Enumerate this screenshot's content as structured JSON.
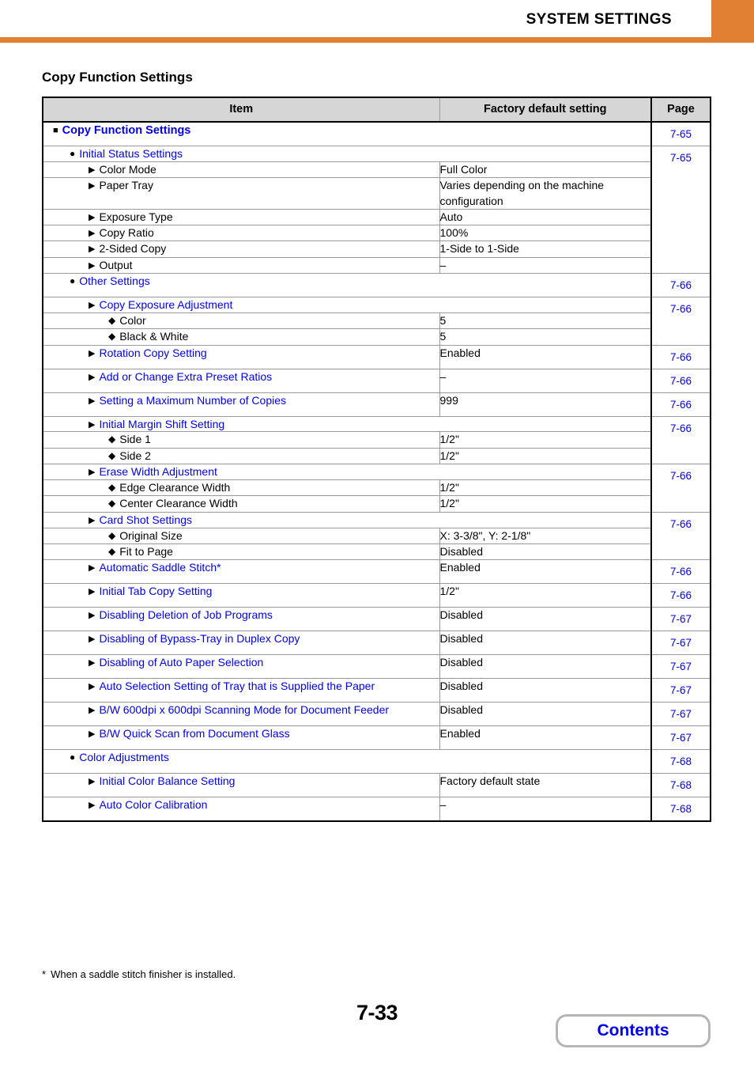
{
  "header": {
    "title": "SYSTEM SETTINGS",
    "accent_color": "#e18032"
  },
  "section": {
    "title": "Copy Function Settings"
  },
  "table": {
    "columns": [
      "Item",
      "Factory default setting",
      "Page"
    ],
    "rows": [
      {
        "level": 1,
        "bullet": "square",
        "item": "Copy Function Settings",
        "link": true,
        "bold": true,
        "value": null,
        "value_merged": true,
        "page": "7-65",
        "page_rowspan": 1
      },
      {
        "level": 2,
        "bullet": "circle",
        "item": "Initial Status Settings",
        "link": true,
        "bold": false,
        "value": null,
        "value_merged": true,
        "page": "7-65",
        "page_rowspan": 7
      },
      {
        "level": 3,
        "bullet": "triangle",
        "item": "Color Mode",
        "link": false,
        "bold": false,
        "value": "Full Color",
        "value_merged": false,
        "page": null
      },
      {
        "level": 3,
        "bullet": "triangle",
        "item": "Paper Tray",
        "link": false,
        "bold": false,
        "value": "Varies depending on the machine configuration",
        "value_merged": false,
        "page": null
      },
      {
        "level": 3,
        "bullet": "triangle",
        "item": "Exposure Type",
        "link": false,
        "bold": false,
        "value": "Auto",
        "value_merged": false,
        "page": null
      },
      {
        "level": 3,
        "bullet": "triangle",
        "item": "Copy Ratio",
        "link": false,
        "bold": false,
        "value": "100%",
        "value_merged": false,
        "page": null
      },
      {
        "level": 3,
        "bullet": "triangle",
        "item": "2-Sided Copy",
        "link": false,
        "bold": false,
        "value": "1-Side to 1-Side",
        "value_merged": false,
        "page": null
      },
      {
        "level": 3,
        "bullet": "triangle",
        "item": "Output",
        "link": false,
        "bold": false,
        "value": "–",
        "value_merged": false,
        "page": null
      },
      {
        "level": 2,
        "bullet": "circle",
        "item": "Other Settings",
        "link": true,
        "bold": false,
        "value": null,
        "value_merged": true,
        "page": "7-66",
        "page_rowspan": 1
      },
      {
        "level": 3,
        "bullet": "triangle",
        "item": "Copy Exposure Adjustment",
        "link": true,
        "bold": false,
        "value": null,
        "value_merged": true,
        "page": "7-66",
        "page_rowspan": 3
      },
      {
        "level": 4,
        "bullet": "diamond",
        "item": "Color",
        "link": false,
        "bold": false,
        "value": "5",
        "value_merged": false,
        "page": null
      },
      {
        "level": 4,
        "bullet": "diamond",
        "item": "Black & White",
        "link": false,
        "bold": false,
        "value": "5",
        "value_merged": false,
        "page": null
      },
      {
        "level": 3,
        "bullet": "triangle",
        "item": "Rotation Copy Setting",
        "link": true,
        "bold": false,
        "value": "Enabled",
        "value_merged": false,
        "page": "7-66",
        "page_rowspan": 1
      },
      {
        "level": 3,
        "bullet": "triangle",
        "item": "Add or Change Extra Preset Ratios",
        "link": true,
        "bold": false,
        "value": "–",
        "value_merged": false,
        "page": "7-66",
        "page_rowspan": 1
      },
      {
        "level": 3,
        "bullet": "triangle",
        "item": "Setting a Maximum Number of Copies",
        "link": true,
        "bold": false,
        "value": "999",
        "value_merged": false,
        "page": "7-66",
        "page_rowspan": 1
      },
      {
        "level": 3,
        "bullet": "triangle",
        "item": "Initial Margin Shift Setting",
        "link": true,
        "bold": false,
        "value": null,
        "value_merged": true,
        "page": "7-66",
        "page_rowspan": 3
      },
      {
        "level": 4,
        "bullet": "diamond",
        "item": "Side 1",
        "link": false,
        "bold": false,
        "value": "1/2\"",
        "value_merged": false,
        "page": null
      },
      {
        "level": 4,
        "bullet": "diamond",
        "item": "Side 2",
        "link": false,
        "bold": false,
        "value": "1/2\"",
        "value_merged": false,
        "page": null
      },
      {
        "level": 3,
        "bullet": "triangle",
        "item": "Erase Width Adjustment",
        "link": true,
        "bold": false,
        "value": null,
        "value_merged": true,
        "page": "7-66",
        "page_rowspan": 3
      },
      {
        "level": 4,
        "bullet": "diamond",
        "item": "Edge Clearance Width",
        "link": false,
        "bold": false,
        "value": "1/2\"",
        "value_merged": false,
        "page": null
      },
      {
        "level": 4,
        "bullet": "diamond",
        "item": "Center Clearance Width",
        "link": false,
        "bold": false,
        "value": "1/2\"",
        "value_merged": false,
        "page": null
      },
      {
        "level": 3,
        "bullet": "triangle",
        "item": "Card Shot Settings",
        "link": true,
        "bold": false,
        "value": null,
        "value_merged": true,
        "page": "7-66",
        "page_rowspan": 3
      },
      {
        "level": 4,
        "bullet": "diamond",
        "item": "Original Size",
        "link": false,
        "bold": false,
        "value": "X: 3-3/8\", Y: 2-1/8\"",
        "value_merged": false,
        "page": null
      },
      {
        "level": 4,
        "bullet": "diamond",
        "item": "Fit to Page",
        "link": false,
        "bold": false,
        "value": "Disabled",
        "value_merged": false,
        "page": null
      },
      {
        "level": 3,
        "bullet": "triangle",
        "item": "Automatic Saddle Stitch*",
        "link": true,
        "bold": false,
        "value": "Enabled",
        "value_merged": false,
        "page": "7-66",
        "page_rowspan": 1
      },
      {
        "level": 3,
        "bullet": "triangle",
        "item": "Initial Tab Copy Setting",
        "link": true,
        "bold": false,
        "value": "1/2\"",
        "value_merged": false,
        "page": "7-66",
        "page_rowspan": 1
      },
      {
        "level": 3,
        "bullet": "triangle",
        "item": "Disabling Deletion of Job Programs",
        "link": true,
        "bold": false,
        "value": "Disabled",
        "value_merged": false,
        "page": "7-67",
        "page_rowspan": 1
      },
      {
        "level": 3,
        "bullet": "triangle",
        "item": "Disabling of Bypass-Tray in Duplex Copy",
        "link": true,
        "bold": false,
        "value": "Disabled",
        "value_merged": false,
        "page": "7-67",
        "page_rowspan": 1
      },
      {
        "level": 3,
        "bullet": "triangle",
        "item": "Disabling of Auto Paper Selection",
        "link": true,
        "bold": false,
        "value": "Disabled",
        "value_merged": false,
        "page": "7-67",
        "page_rowspan": 1
      },
      {
        "level": 3,
        "bullet": "triangle",
        "item": "Auto Selection Setting of Tray that is Supplied the Paper",
        "link": true,
        "bold": false,
        "value": "Disabled",
        "value_merged": false,
        "page": "7-67",
        "page_rowspan": 1
      },
      {
        "level": 3,
        "bullet": "triangle",
        "item": "B/W 600dpi x 600dpi Scanning Mode for Document Feeder",
        "link": true,
        "bold": false,
        "value": "Disabled",
        "value_merged": false,
        "page": "7-67",
        "page_rowspan": 1
      },
      {
        "level": 3,
        "bullet": "triangle",
        "item": "B/W Quick Scan from Document Glass",
        "link": true,
        "bold": false,
        "value": "Enabled",
        "value_merged": false,
        "page": "7-67",
        "page_rowspan": 1
      },
      {
        "level": 2,
        "bullet": "circle",
        "item": "Color Adjustments",
        "link": true,
        "bold": false,
        "value": null,
        "value_merged": true,
        "page": "7-68",
        "page_rowspan": 1
      },
      {
        "level": 3,
        "bullet": "triangle",
        "item": "Initial Color Balance Setting",
        "link": true,
        "bold": false,
        "value": "Factory default state",
        "value_merged": false,
        "page": "7-68",
        "page_rowspan": 1
      },
      {
        "level": 3,
        "bullet": "triangle",
        "item": "Auto Color Calibration",
        "link": true,
        "bold": false,
        "value": "–",
        "value_merged": false,
        "page": "7-68",
        "page_rowspan": 1
      }
    ]
  },
  "footnote": {
    "marker": "*",
    "text": "When a saddle stitch finisher is installed."
  },
  "footer": {
    "page_number": "7-33",
    "contents_label": "Contents"
  }
}
